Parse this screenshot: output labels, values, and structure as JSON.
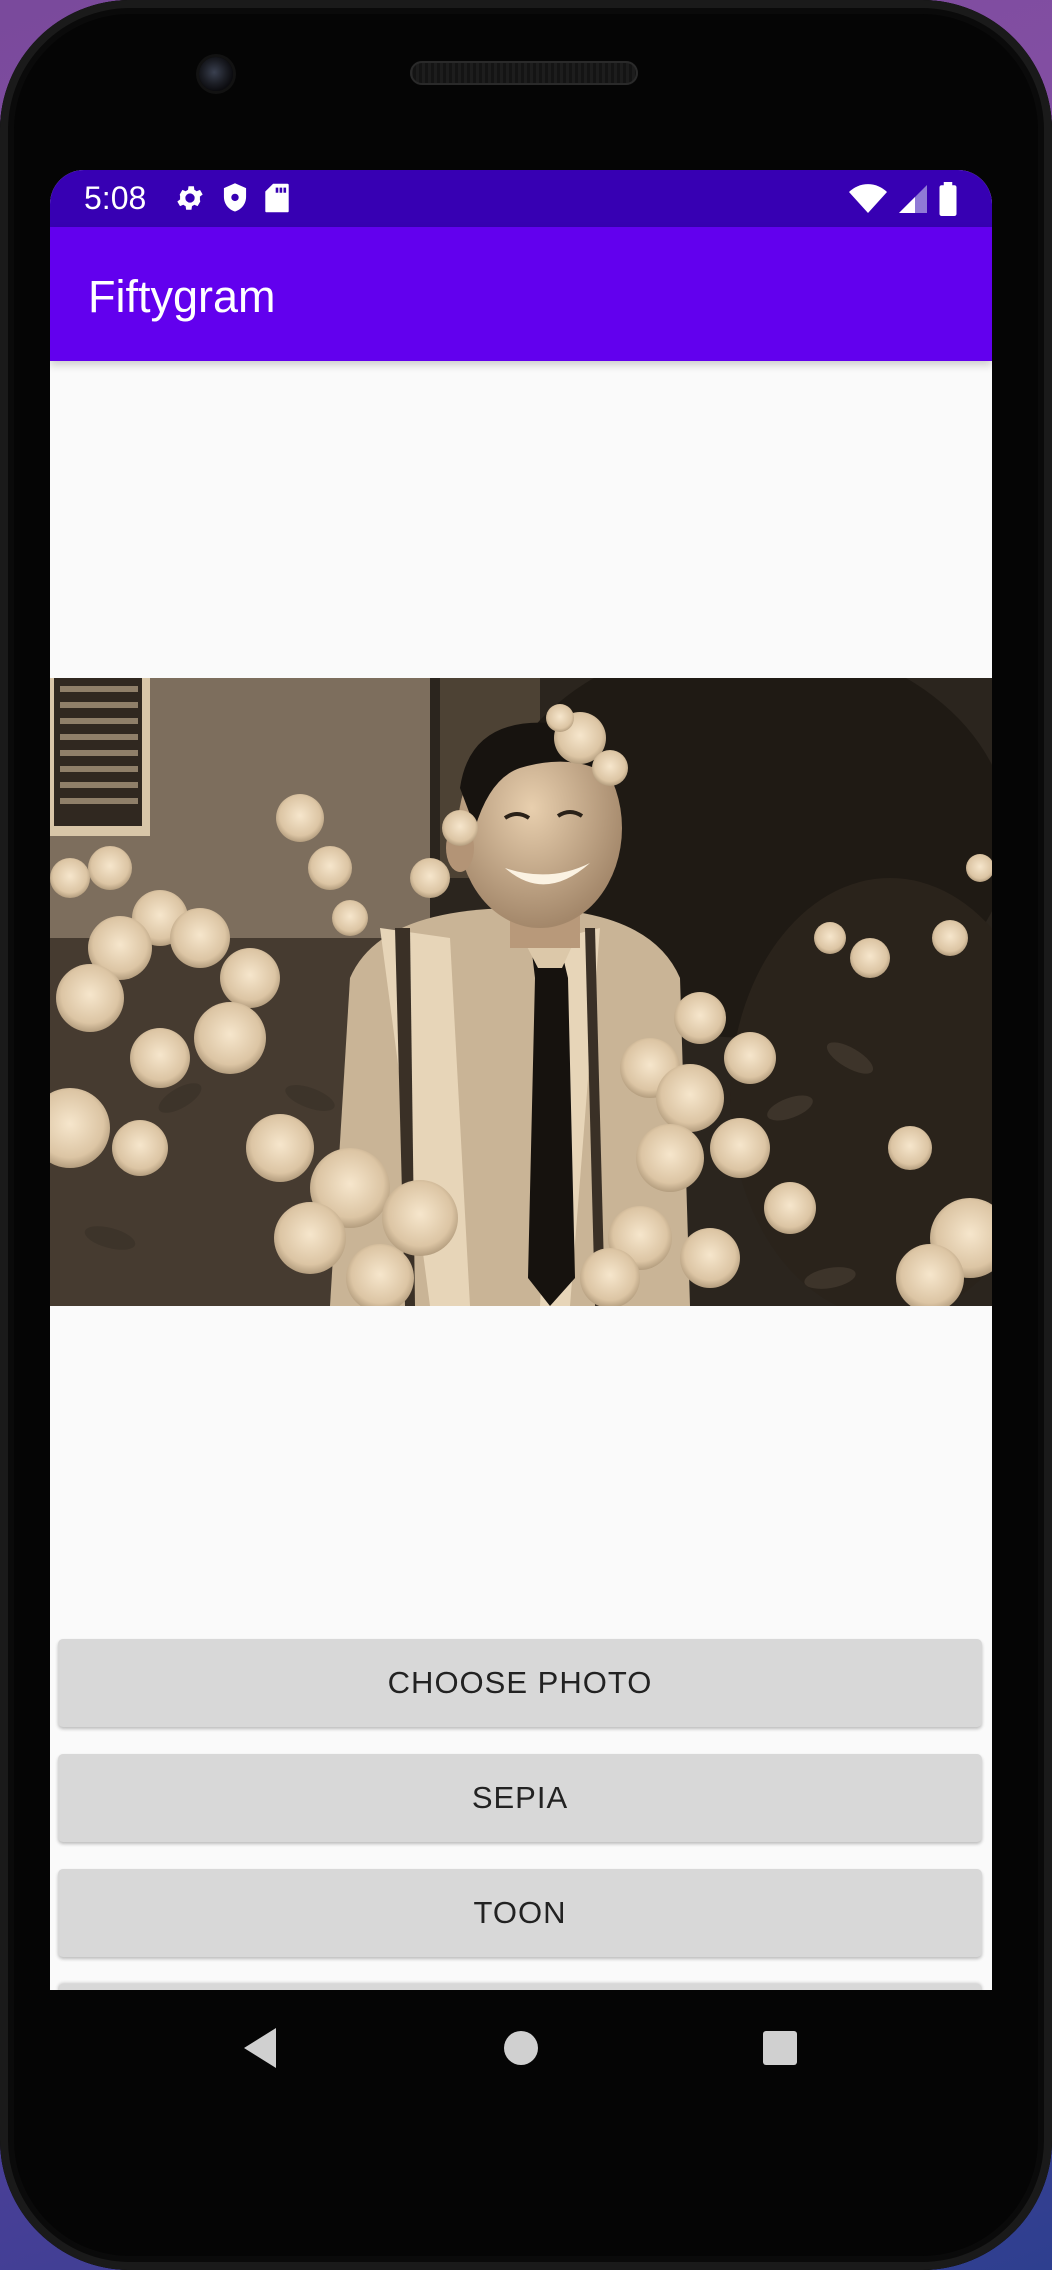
{
  "status_bar": {
    "time": "5:08",
    "left_icons": [
      "settings-icon",
      "shield-icon",
      "sd-card-icon"
    ],
    "right_icons": [
      "wifi-icon",
      "cell-signal-icon",
      "battery-icon"
    ]
  },
  "app_bar": {
    "title": "Fiftygram"
  },
  "image": {
    "description_name": "sepia-photo",
    "filter": "sepia"
  },
  "buttons": {
    "choose_photo": "CHOOSE PHOTO",
    "sepia": "SEPIA",
    "toon": "TOON"
  },
  "nav_bar": {
    "back": "back-icon",
    "home": "home-icon",
    "recents": "recents-icon"
  },
  "colors": {
    "status_bar": "#3700b3",
    "app_bar": "#6200ee",
    "button_bg": "#d8d8d8",
    "screen_bg": "#fafafa"
  }
}
